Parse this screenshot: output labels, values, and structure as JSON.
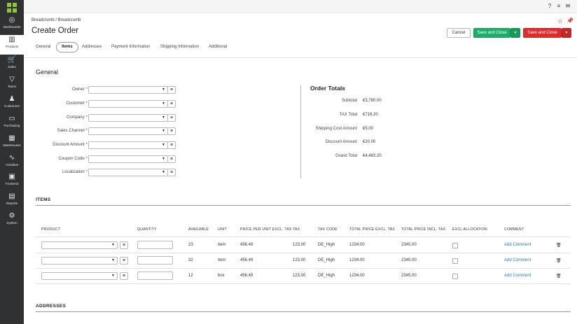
{
  "sidebar": {
    "items": [
      {
        "label": "Dashboards",
        "icon": "dashboard-icon",
        "glyph": "◎"
      },
      {
        "label": "Products",
        "icon": "barcode-icon",
        "glyph": "▥"
      },
      {
        "label": "Sales",
        "icon": "cart-icon",
        "glyph": "🛒"
      },
      {
        "label": "Taxes",
        "icon": "filter-icon",
        "glyph": "▽"
      },
      {
        "label": "Customers",
        "icon": "users-icon",
        "glyph": "♟"
      },
      {
        "label": "Purchasing",
        "icon": "inbox-icon",
        "glyph": "▭"
      },
      {
        "label": "Warehouses",
        "icon": "warehouse-icon",
        "glyph": "▦"
      },
      {
        "label": "Activities",
        "icon": "pulse-icon",
        "glyph": "∿"
      },
      {
        "label": "Frontend",
        "icon": "window-icon",
        "glyph": "▣"
      },
      {
        "label": "Reports",
        "icon": "clipboard-icon",
        "glyph": "▤"
      },
      {
        "label": "System",
        "icon": "gear-icon",
        "glyph": "⚙"
      }
    ]
  },
  "topbar": {
    "help_glyph": "?",
    "menu_glyph": "≡",
    "mail_glyph": "✉"
  },
  "header": {
    "breadcrumb": "Breadcrumb / Breadcrumb",
    "title": "Create Order",
    "star_glyph": "☆",
    "pin_glyph": "📌",
    "cancel_label": "Cancel",
    "save_close_green_label": "Save and Close",
    "save_close_red_label": "Save and Close",
    "caret_glyph": "▾"
  },
  "tabs": [
    {
      "label": "General",
      "active": false
    },
    {
      "label": "Items",
      "active": true
    },
    {
      "label": "Addresses",
      "active": false
    },
    {
      "label": "Payment Information",
      "active": false
    },
    {
      "label": "Shipping Information",
      "active": false
    },
    {
      "label": "Additional",
      "active": false
    }
  ],
  "general": {
    "title": "General",
    "required_mark": "*",
    "caret_glyph": "▼",
    "list_glyph": "≡",
    "fields": [
      {
        "label": "Owner",
        "value": ""
      },
      {
        "label": "Customer",
        "value": ""
      },
      {
        "label": "Company",
        "value": ""
      },
      {
        "label": "Sales Channel",
        "value": ""
      },
      {
        "label": "Discount Amount",
        "value": ""
      },
      {
        "label": "Coupon Code",
        "value": ""
      },
      {
        "label": "Localization",
        "value": ""
      }
    ]
  },
  "totals": {
    "title": "Order Totals",
    "rows": [
      {
        "label": "Subtotal",
        "value": "€3,780.00"
      },
      {
        "label": "TAX Total",
        "value": "€718.20"
      },
      {
        "label": "Shipping Cost Amount",
        "value": "€5.00"
      },
      {
        "label": "Discount Amount",
        "value": "€20.00"
      },
      {
        "label": "Grand Total",
        "value": "€4,483.20"
      }
    ]
  },
  "items": {
    "title": "ITEMS",
    "columns": [
      "PRODUCT",
      "QUANTITY",
      "AVAILABLE",
      "UNIT",
      "PRICE PER UNIT EXCL. TAX",
      "TAX",
      "TAX CODE",
      "TOTAL PRICE EXCL. TAX",
      "TOTAL PRICE INCL. TAX",
      "EXCL ALLOCATION",
      "COMMENT"
    ],
    "comment_link": "Add Comment",
    "trash_glyph": "🗑",
    "rows": [
      {
        "product": "",
        "quantity": "",
        "available": "23",
        "unit": "item",
        "price": "456.49",
        "tax": "123.00",
        "tax_code": "DE_High",
        "total_excl": "1234.00",
        "total_incl": "2345.00"
      },
      {
        "product": "",
        "quantity": "",
        "available": "32",
        "unit": "item",
        "price": "456.49",
        "tax": "123.00",
        "tax_code": "DE_High",
        "total_excl": "1234.00",
        "total_incl": "2345.00"
      },
      {
        "product": "",
        "quantity": "",
        "available": "12",
        "unit": "box",
        "price": "456.49",
        "tax": "123.00",
        "tax_code": "DE_High",
        "total_excl": "1234.00",
        "total_incl": "2345.00"
      }
    ]
  },
  "addresses": {
    "title": "ADDRESSES"
  },
  "colors": {
    "sidebar": "#2f3133",
    "logo": "#8cc63f",
    "primary_green": "#1fac6a",
    "primary_red": "#dd2d2d",
    "link": "#1c7fc0"
  }
}
